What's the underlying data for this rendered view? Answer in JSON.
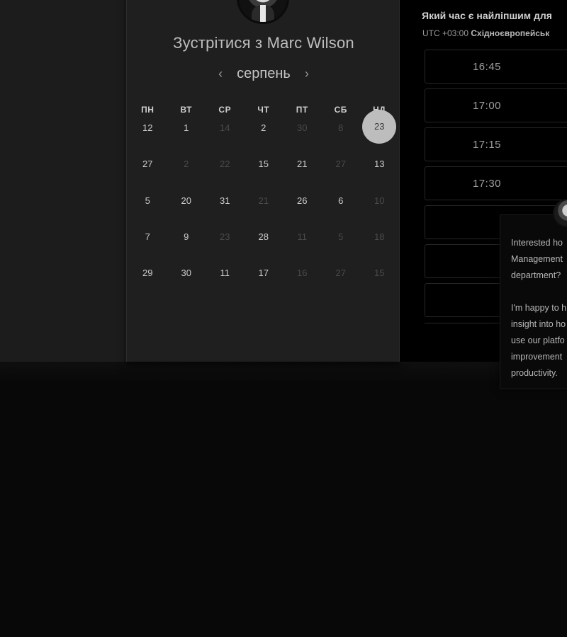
{
  "scheduler": {
    "meet_title": "Зустрітися з Marc Wilson",
    "month_label": "серпень",
    "prev_month_icon": "chevron-left-icon",
    "next_month_icon": "chevron-right-icon",
    "weekdays": [
      "ПН",
      "ВТ",
      "СР",
      "ЧТ",
      "ПТ",
      "СБ",
      "НД"
    ],
    "weeks": [
      [
        {
          "d": "12",
          "on": true
        },
        {
          "d": "1",
          "on": true
        },
        {
          "d": "14",
          "on": false
        },
        {
          "d": "2",
          "on": true
        },
        {
          "d": "30",
          "on": false
        },
        {
          "d": "8",
          "on": false
        },
        {
          "d": "23",
          "on": true,
          "selected": true
        }
      ],
      [
        {
          "d": "27",
          "on": true
        },
        {
          "d": "2",
          "on": false
        },
        {
          "d": "22",
          "on": false
        },
        {
          "d": "15",
          "on": true
        },
        {
          "d": "21",
          "on": true
        },
        {
          "d": "27",
          "on": false
        },
        {
          "d": "13",
          "on": true
        }
      ],
      [
        {
          "d": "5",
          "on": true
        },
        {
          "d": "20",
          "on": true
        },
        {
          "d": "31",
          "on": true
        },
        {
          "d": "21",
          "on": false
        },
        {
          "d": "26",
          "on": true
        },
        {
          "d": "6",
          "on": true
        },
        {
          "d": "10",
          "on": false
        }
      ],
      [
        {
          "d": "7",
          "on": true
        },
        {
          "d": "9",
          "on": true
        },
        {
          "d": "23",
          "on": false
        },
        {
          "d": "28",
          "on": true
        },
        {
          "d": "11",
          "on": false
        },
        {
          "d": "5",
          "on": false
        },
        {
          "d": "18",
          "on": false
        }
      ],
      [
        {
          "d": "29",
          "on": true
        },
        {
          "d": "30",
          "on": true
        },
        {
          "d": "11",
          "on": true
        },
        {
          "d": "17",
          "on": true
        },
        {
          "d": "16",
          "on": false
        },
        {
          "d": "27",
          "on": false
        },
        {
          "d": "15",
          "on": false
        }
      ]
    ]
  },
  "times": {
    "question": "Який час є найліпшим для",
    "tz_prefix": "UTC +03:00 ",
    "tz_name": "Східноєвропейськ",
    "slots": [
      "16:45",
      "17:00",
      "17:15",
      "17:30",
      "",
      "",
      ""
    ]
  },
  "chat": {
    "message": "Interested ho\nManagement\ndepartment?\n\nI'm happy to h\ninsight into ho\nuse our platfo\nimprovement\nproductivity."
  },
  "colors": {
    "background": "#080808",
    "panel": "#1f1f1f",
    "selected_day": "#bdbdbd"
  }
}
